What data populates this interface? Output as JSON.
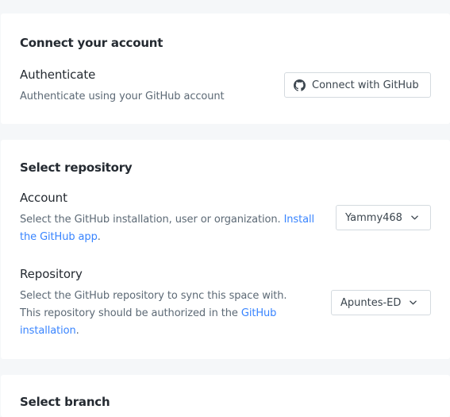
{
  "connect": {
    "title": "Connect your account",
    "auth_label": "Authenticate",
    "auth_desc": "Authenticate using your GitHub account",
    "button_label": "Connect with GitHub",
    "button_icon": "github-icon"
  },
  "select_repo": {
    "title": "Select repository",
    "account": {
      "label": "Account",
      "desc_prefix": "Select the GitHub installation, user or organization.",
      "desc_link": "Install the GitHub app",
      "desc_suffix": ".",
      "selected": "Yammy468"
    },
    "repository": {
      "label": "Repository",
      "desc_prefix": "Select the GitHub repository to sync this space with. This repository should be authorized in the",
      "desc_link": "GitHub installation",
      "desc_suffix": ".",
      "selected": "Apuntes-ED"
    }
  },
  "select_branch": {
    "title": "Select branch"
  },
  "colors": {
    "background": "#f5f7f9",
    "card": "#ffffff",
    "link": "#3884ff",
    "title": "#242a31",
    "muted": "#5c6975",
    "border": "#d4dadf"
  }
}
